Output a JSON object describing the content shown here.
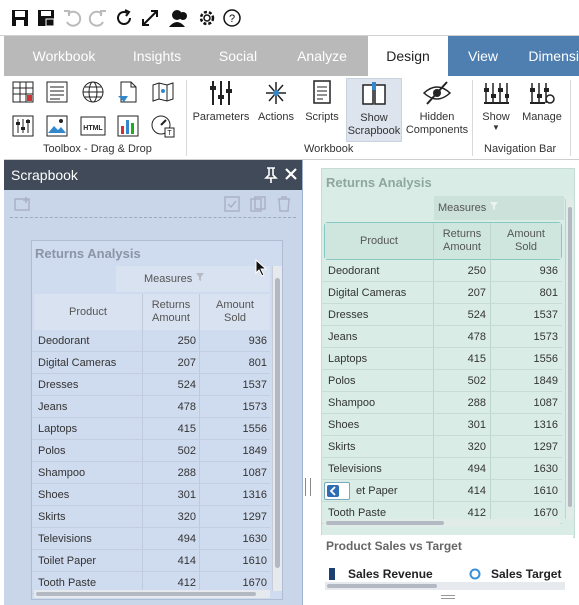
{
  "toolbar": {
    "icons": [
      "save-icon",
      "save-as-icon",
      "undo-icon",
      "redo-icon",
      "refresh-icon",
      "fullscreen-icon",
      "users-icon",
      "gear-icon",
      "help-icon"
    ]
  },
  "tabs": [
    {
      "label": "Workbook"
    },
    {
      "label": "Insights"
    },
    {
      "label": "Social"
    },
    {
      "label": "Analyze"
    },
    {
      "label": "Design"
    },
    {
      "label": "View"
    },
    {
      "label": "Dimensi"
    }
  ],
  "ribbon": {
    "toolbox_label": "Toolbox - Drag & Drop",
    "workbook_label": "Workbook",
    "navbar_label": "Navigation Bar",
    "buttons": {
      "parameters": "Parameters",
      "actions": "Actions",
      "scripts": "Scripts",
      "show_scrapbook_1": "Show",
      "show_scrapbook_2": "Scrapbook",
      "hidden_1": "Hidden",
      "hidden_2": "Components",
      "show": "Show",
      "manage": "Manage"
    }
  },
  "scrapbook": {
    "title": "Scrapbook",
    "pin_icon": "pin-icon",
    "close_icon": "close-icon"
  },
  "report": {
    "title": "Returns Analysis",
    "measures": "Measures",
    "col_product": "Product",
    "col_returns_1": "Returns",
    "col_returns_2": "Amount",
    "col_sold_1": "Amount",
    "col_sold_2": "Sold",
    "rows": [
      {
        "product": "Deodorant",
        "returns": "250",
        "sold": "936"
      },
      {
        "product": "Digital Cameras",
        "returns": "207",
        "sold": "801"
      },
      {
        "product": "Dresses",
        "returns": "524",
        "sold": "1537"
      },
      {
        "product": "Jeans",
        "returns": "478",
        "sold": "1573"
      },
      {
        "product": "Laptops",
        "returns": "415",
        "sold": "1556"
      },
      {
        "product": "Polos",
        "returns": "502",
        "sold": "1849"
      },
      {
        "product": "Shampoo",
        "returns": "288",
        "sold": "1087"
      },
      {
        "product": "Shoes",
        "returns": "301",
        "sold": "1316"
      },
      {
        "product": "Skirts",
        "returns": "320",
        "sold": "1297"
      },
      {
        "product": "Televisions",
        "returns": "494",
        "sold": "1630"
      },
      {
        "product": "Toilet Paper",
        "returns": "414",
        "sold": "1610"
      },
      {
        "product": "Tooth Paste",
        "returns": "412",
        "sold": "1670"
      }
    ]
  },
  "right_rows_product_toilet": "et Paper",
  "bottom_chart": {
    "title": "Product Sales vs Target",
    "legend_1": "Sales Revenue",
    "legend_2": "Sales Target"
  },
  "colors": {
    "accent": "#4e7fb0",
    "scrap_header": "#404a58",
    "green_panel": "#d9ede6"
  }
}
